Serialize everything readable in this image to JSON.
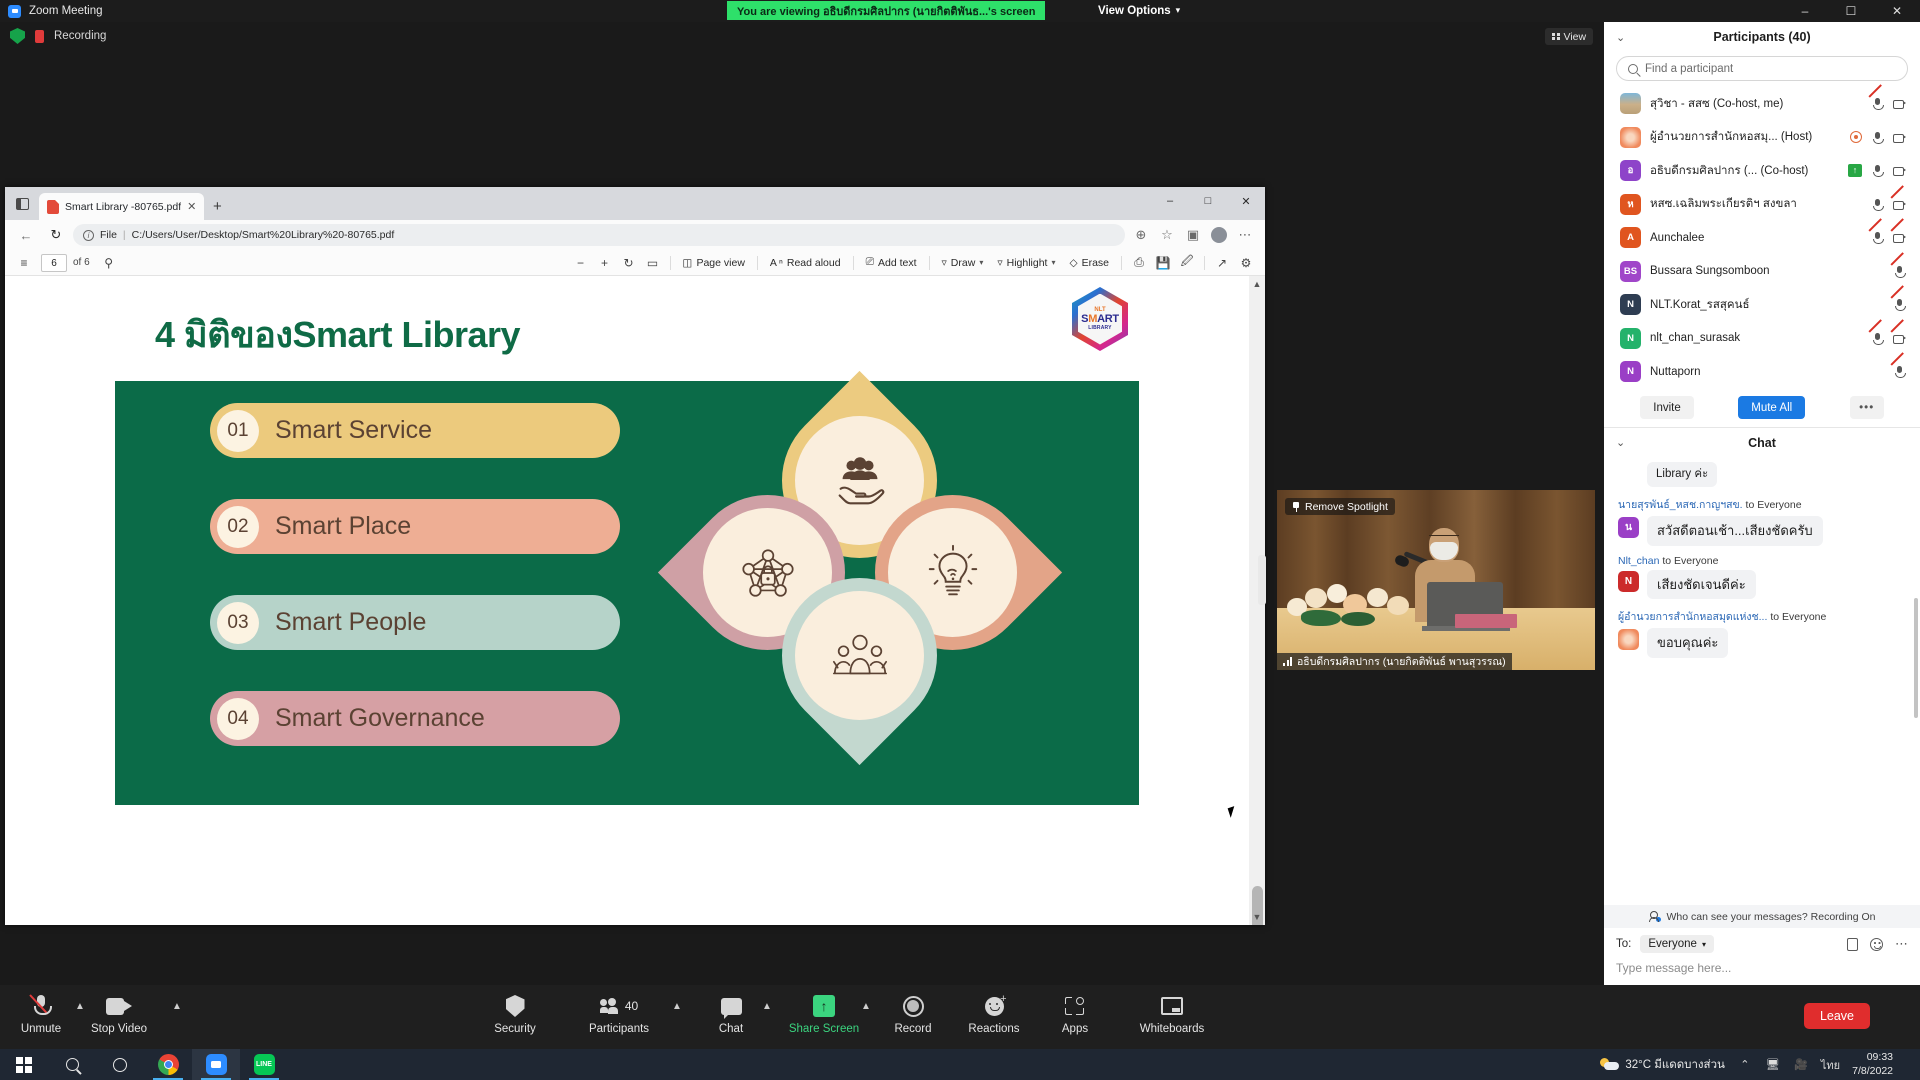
{
  "window": {
    "app_title": "Zoom Meeting",
    "share_banner": "You are viewing อธิบดีกรมศิลปากร (นายกิตติพันธ...'s screen",
    "view_options": "View Options",
    "minimize": "–",
    "maximize": "☐",
    "close": "✕",
    "recording_label": "Recording",
    "view_button": "View"
  },
  "browser": {
    "tab_title": "Smart Library -80765.pdf",
    "tab_close": "✕",
    "new_tab": "+",
    "back": "←",
    "reload": "↻",
    "url_scheme": "File",
    "url_sep": "|",
    "url_path": "C:/Users/User/Desktop/Smart%20Library%20-80765.pdf",
    "win_minimize": "–",
    "win_maximize": "□",
    "win_close": "✕",
    "pdf_toolbar": {
      "page_current": "6",
      "page_total": "of 6",
      "zoom_out": "−",
      "zoom_in": "+",
      "rotate": "↻",
      "fit": "▭",
      "page_view": "Page view",
      "read_aloud": "Read aloud",
      "add_text": "Add text",
      "draw": "Draw",
      "highlight": "Highlight",
      "erase": "Erase",
      "print": "⎙",
      "save": "Ὃe",
      "save_as": "✎",
      "fullscreen": "↗",
      "settings": "⚙"
    }
  },
  "slide": {
    "title": "4 มิติของSmart Library",
    "logo": {
      "line1": "NLT",
      "line2_a": "S",
      "line2_b": "M",
      "line2_c": "ART",
      "line3": "LIBRARY"
    },
    "bars": [
      {
        "num": "01",
        "label": "Smart Service",
        "bg": "#ecca7d",
        "text": "#5b4233"
      },
      {
        "num": "02",
        "label": "Smart Place",
        "bg": "#eeae94",
        "text": "#5b4233"
      },
      {
        "num": "03",
        "label": "Smart People",
        "bg": "#b6d3c9",
        "text": "#5b4233"
      },
      {
        "num": "04",
        "label": "Smart Governance",
        "bg": "#d6a0a4",
        "text": "#5b4233"
      }
    ],
    "petals": [
      {
        "name": "smart-service-petal",
        "icon": "hand-people-icon",
        "color": "#eccb80"
      },
      {
        "name": "smart-place-petal",
        "icon": "lightbulb-wifi-icon",
        "color": "#e3a488"
      },
      {
        "name": "smart-governance-petal",
        "icon": "network-lock-icon",
        "color": "#cfa0a5"
      },
      {
        "name": "smart-people-petal",
        "icon": "team-people-icon",
        "color": "#c3d8cf"
      }
    ],
    "bg_green": "#0b6b48",
    "title_green": "#0f6b46"
  },
  "spotlight": {
    "remove_spotlight": "Remove Spotlight",
    "speaker_name": "อธิบดีกรมศิลปากร (นายกิตติพันธ์ พานสุวรรณ)"
  },
  "participants_panel": {
    "title": "Participants (40)",
    "collapse": "⌄",
    "search_placeholder": "Find a participant",
    "list": [
      {
        "name": "สุวิชา - สสซ (Co-host, me)",
        "initial": "",
        "color": "#6f9fc2",
        "photo": true,
        "mic": "muted",
        "cam": "on"
      },
      {
        "name": "ผู้อำนวยการสำนักหอสมุ... (Host)",
        "initial": "",
        "color": "#f08a5d",
        "photo": true,
        "mic": "on",
        "cam": "on",
        "badge": "host"
      },
      {
        "name": "อธิบดีกรมศิลปากร (... (Co-host)",
        "initial": "อ",
        "color": "#8e44c9",
        "mic": "on",
        "cam": "on",
        "badge": "share"
      },
      {
        "name": "หสซ.เฉลิมพระเกียรติฯ สงขลา",
        "initial": "ห",
        "color": "#e0551f",
        "mic": "on",
        "cam": "off"
      },
      {
        "name": "Aunchalee",
        "initial": "A",
        "color": "#e0551f",
        "mic": "muted",
        "cam": "off"
      },
      {
        "name": "Bussara Sungsomboon",
        "initial": "BS",
        "color": "#a046c9",
        "mic": "muted",
        "cam": "none"
      },
      {
        "name": "NLT.Korat_รสสุคนธ์",
        "initial": "N",
        "color": "#2e3d52",
        "mic": "muted",
        "cam": "none"
      },
      {
        "name": "nlt_chan_surasak",
        "initial": "N",
        "color": "#24b26b",
        "mic": "muted",
        "cam": "off"
      },
      {
        "name": "Nuttaporn",
        "initial": "N",
        "color": "#9a3fc6",
        "mic": "muted",
        "cam": "none"
      }
    ],
    "buttons": {
      "invite": "Invite",
      "mute_all": "Mute All",
      "more": "•••"
    }
  },
  "chat_panel": {
    "title": "Chat",
    "collapse": "⌄",
    "messages": [
      {
        "from": "",
        "to": "",
        "text": "Library ค่ะ",
        "initial": "",
        "color": "",
        "partial": true
      },
      {
        "from": "นายสุรพันธ์_หสช.กาญฯสข.",
        "to": "to Everyone",
        "text": "สวัสดีตอนเช้า...เสียงชัดครับ",
        "initial": "น",
        "color": "#9a3fc6"
      },
      {
        "from": "Nlt_chan",
        "to": "to Everyone",
        "text": "เสียงชัดเจนดีค่ะ",
        "initial": "N",
        "color": "#cc2b2b"
      },
      {
        "from": "ผู้อำนวยการสำนักหอสมุดแห่งช...",
        "to": "to Everyone",
        "text": "ขอบคุณค่ะ",
        "initial": "",
        "color": "#f08a5d",
        "photo": true
      }
    ],
    "privacy_note": "Who can see your messages? Recording On",
    "to_label": "To:",
    "to_value": "Everyone",
    "input_placeholder": "Type message here..."
  },
  "zoom_toolbar": {
    "items": [
      {
        "label": "Unmute",
        "icon": "mic-muted-icon",
        "caret": true
      },
      {
        "label": "Stop Video",
        "icon": "camera-icon",
        "caret": true
      },
      {
        "label": "Security",
        "icon": "shield-icon",
        "caret": false
      },
      {
        "label": "Participants",
        "icon": "people-icon",
        "caret": true,
        "count": "40"
      },
      {
        "label": "Chat",
        "icon": "chat-bubble-icon",
        "caret": true
      },
      {
        "label": "Share Screen",
        "icon": "share-screen-icon",
        "caret": true,
        "highlight": "#3bd47f"
      },
      {
        "label": "Record",
        "icon": "record-icon",
        "caret": false
      },
      {
        "label": "Reactions",
        "icon": "reactions-icon",
        "caret": false
      },
      {
        "label": "Apps",
        "icon": "apps-icon",
        "caret": false
      },
      {
        "label": "Whiteboards",
        "icon": "whiteboard-icon",
        "caret": false
      }
    ],
    "leave": "Leave"
  },
  "taskbar": {
    "items": [
      {
        "name": "start-button",
        "icon": "windows-logo-icon"
      },
      {
        "name": "search-button",
        "icon": "search-icon"
      },
      {
        "name": "cortana-button",
        "icon": "circle-icon"
      },
      {
        "name": "chrome-taskbar",
        "icon": "chrome-icon",
        "running": true
      },
      {
        "name": "zoom-taskbar",
        "icon": "zoom-icon",
        "running": true,
        "active": true
      },
      {
        "name": "line-taskbar",
        "icon": "line-icon",
        "running": true
      }
    ],
    "weather": "32°C  มีแดดบางส่วน",
    "tray_expand": "⌃",
    "language": "ไทย",
    "time": "09:33",
    "date": "7/8/2022"
  }
}
